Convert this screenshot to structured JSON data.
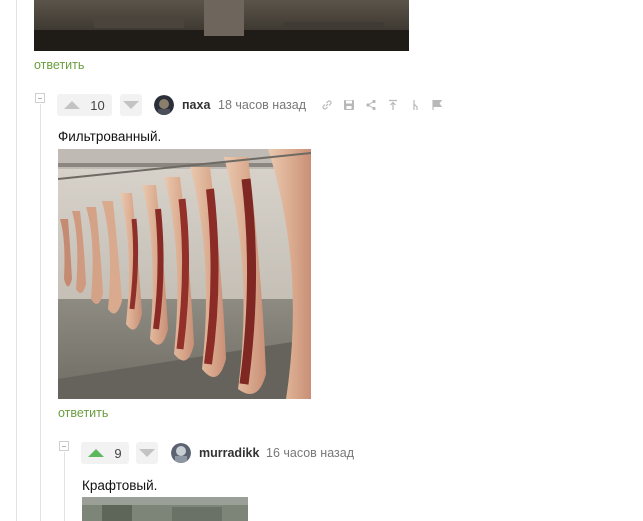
{
  "comments": [
    {
      "reply_label": "ответить"
    },
    {
      "rating": "10",
      "username": "паха",
      "time": "18 часов назад",
      "text": "Фильтрованный.",
      "image_desc": "pig-carcasses-photo",
      "reply_label": "ответить",
      "tools": [
        "link-icon",
        "save-icon",
        "share-icon",
        "scroll-to-parent-icon",
        "branch-icon",
        "flag-icon"
      ]
    },
    {
      "rating": "9",
      "username": "murradikk",
      "time": "16 часов назад",
      "text": "Крафтовый."
    }
  ],
  "colors": {
    "accent_green": "#5cb85c",
    "reply_link": "#6b9e3f"
  }
}
